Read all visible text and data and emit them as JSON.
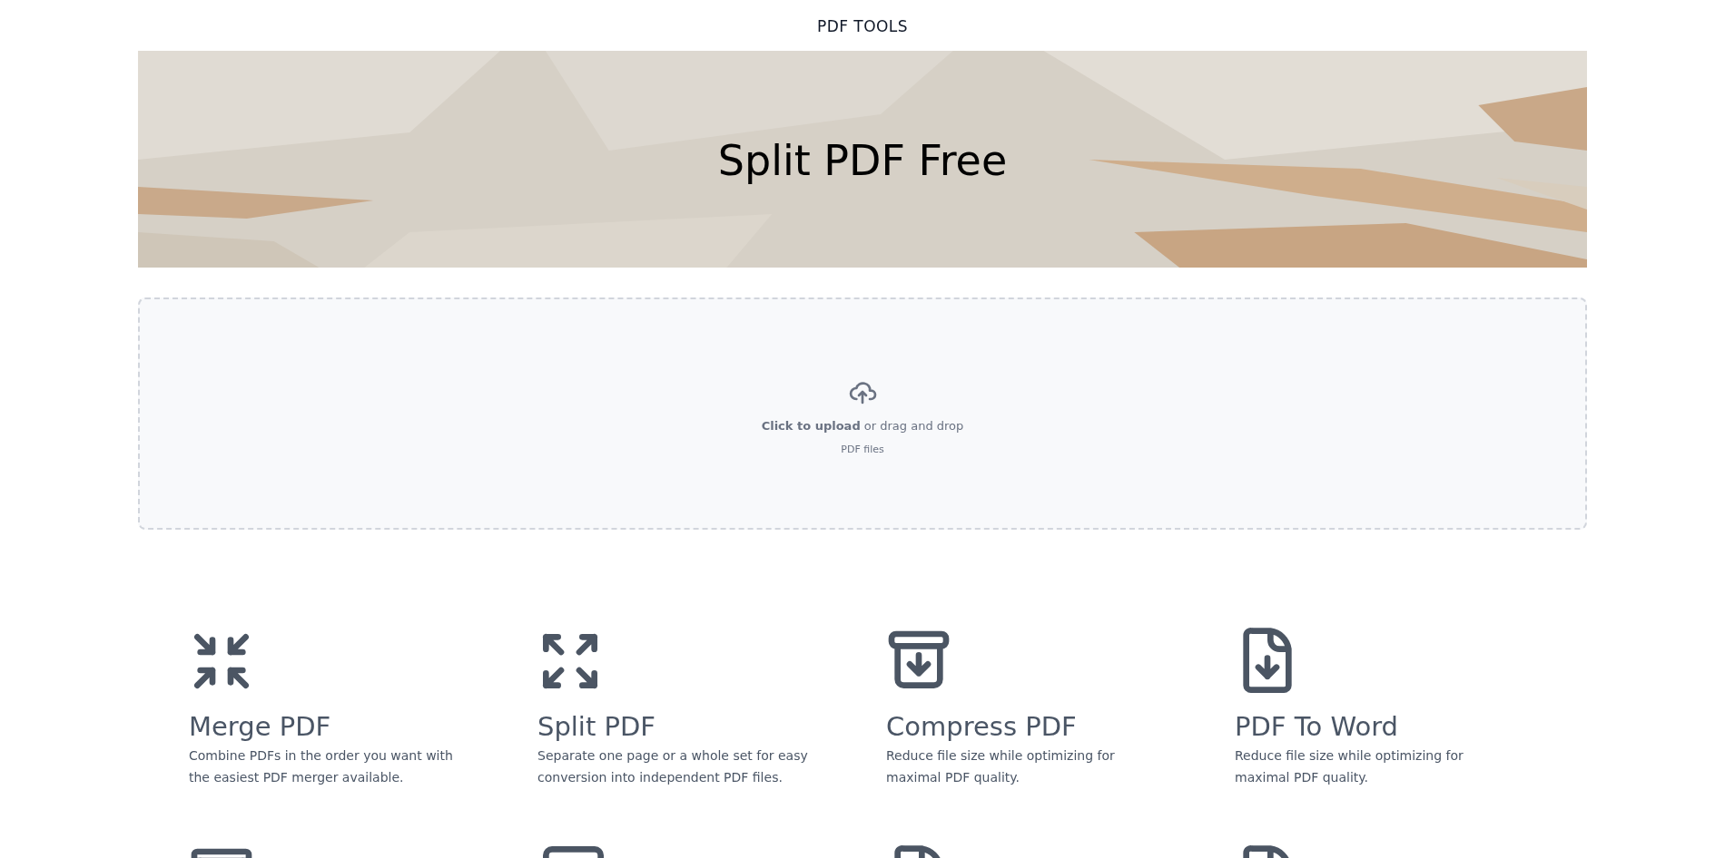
{
  "header": {
    "title": "PDF TOOLS"
  },
  "banner": {
    "title": "Split PDF Free"
  },
  "upload": {
    "prompt": "**Click to upload** or drag and drop",
    "hint": "PDF files"
  },
  "tools": [
    {
      "title": "Merge PDF",
      "description": "Combine PDFs in the order you want with the easiest PDF merger available."
    },
    {
      "title": "Split PDF",
      "description": "Separate one page or a whole set for easy conversion into independent PDF files."
    },
    {
      "title": "Compress PDF",
      "description": "Reduce file size while optimizing for maximal PDF quality."
    },
    {
      "title": "PDF To Word",
      "description": "Reduce file size while optimizing for maximal PDF quality."
    }
  ]
}
